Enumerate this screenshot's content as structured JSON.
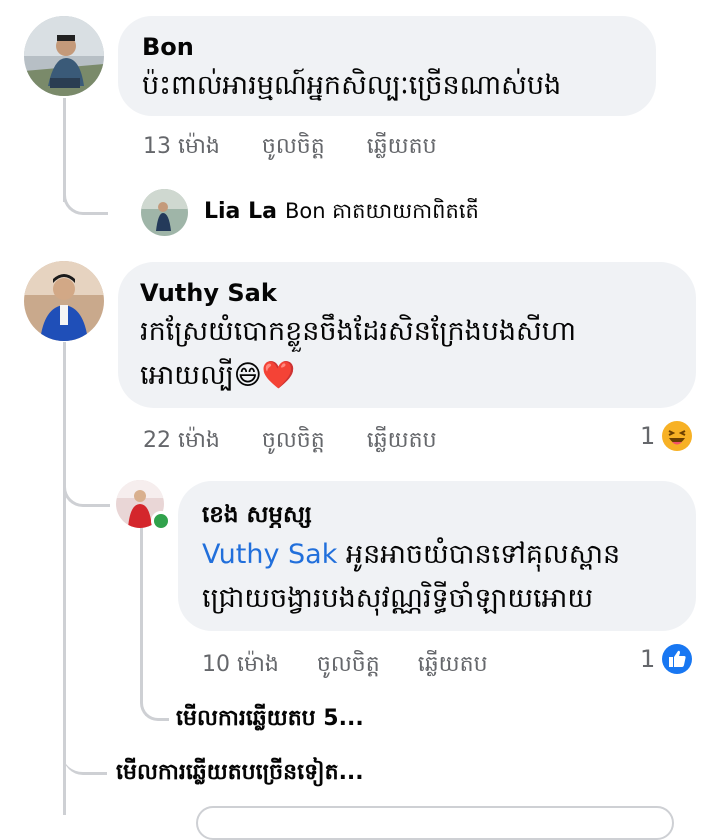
{
  "comments": [
    {
      "author": "Bon",
      "text": "ប៉ះពាល់អារម្មណ៍អ្នកសិល្បៈច្រើនណាស់បង",
      "time": "13 ម៉ោង",
      "like_label": "ចូលចិត្ត",
      "reply_label": "ឆ្លើយតប"
    },
    {
      "author": "Vuthy Sak",
      "text_line1": "រកស្រែយំបោកខ្លួនចឹងដែរសិនក្រែងបងសីហា",
      "text_line2": "អោយល្បី",
      "emoji": "😄❤️",
      "time": "22 ម៉ោង",
      "like_label": "ចូលចិត្ត",
      "reply_label": "ឆ្លើយតប",
      "reaction_count": "1",
      "reaction_icon": "laughing-emoji-icon"
    }
  ],
  "reply_preview": {
    "author": "Lia La",
    "text": "Bon គាតយាយកាពិតតើ"
  },
  "nested_reply": {
    "author": "ខេង សម្ភស្ស",
    "mention": "Vuthy Sak",
    "text_line1": " អូនអាចយំបានទៅគុលស្ពាន",
    "text_line2": "ជ្រោយចង្វារបងសុវណ្ណរិទ្ធីចាំឡាយអោយ",
    "time": "10 ម៉ោង",
    "like_label": "ចូលចិត្ត",
    "reply_label": "ឆ្លើយតប",
    "reaction_count": "1",
    "reaction_icon": "like-thumb-icon"
  },
  "view_replies": "មើលការឆ្លើយតប 5...",
  "view_more": "មើលការឆ្លើយតបច្រើនទៀត...",
  "colors": {
    "bubble": "#f0f2f5",
    "meta": "#65676b",
    "mention": "#216fdb",
    "online": "#31a24c",
    "like_blue": "#1877f2"
  }
}
